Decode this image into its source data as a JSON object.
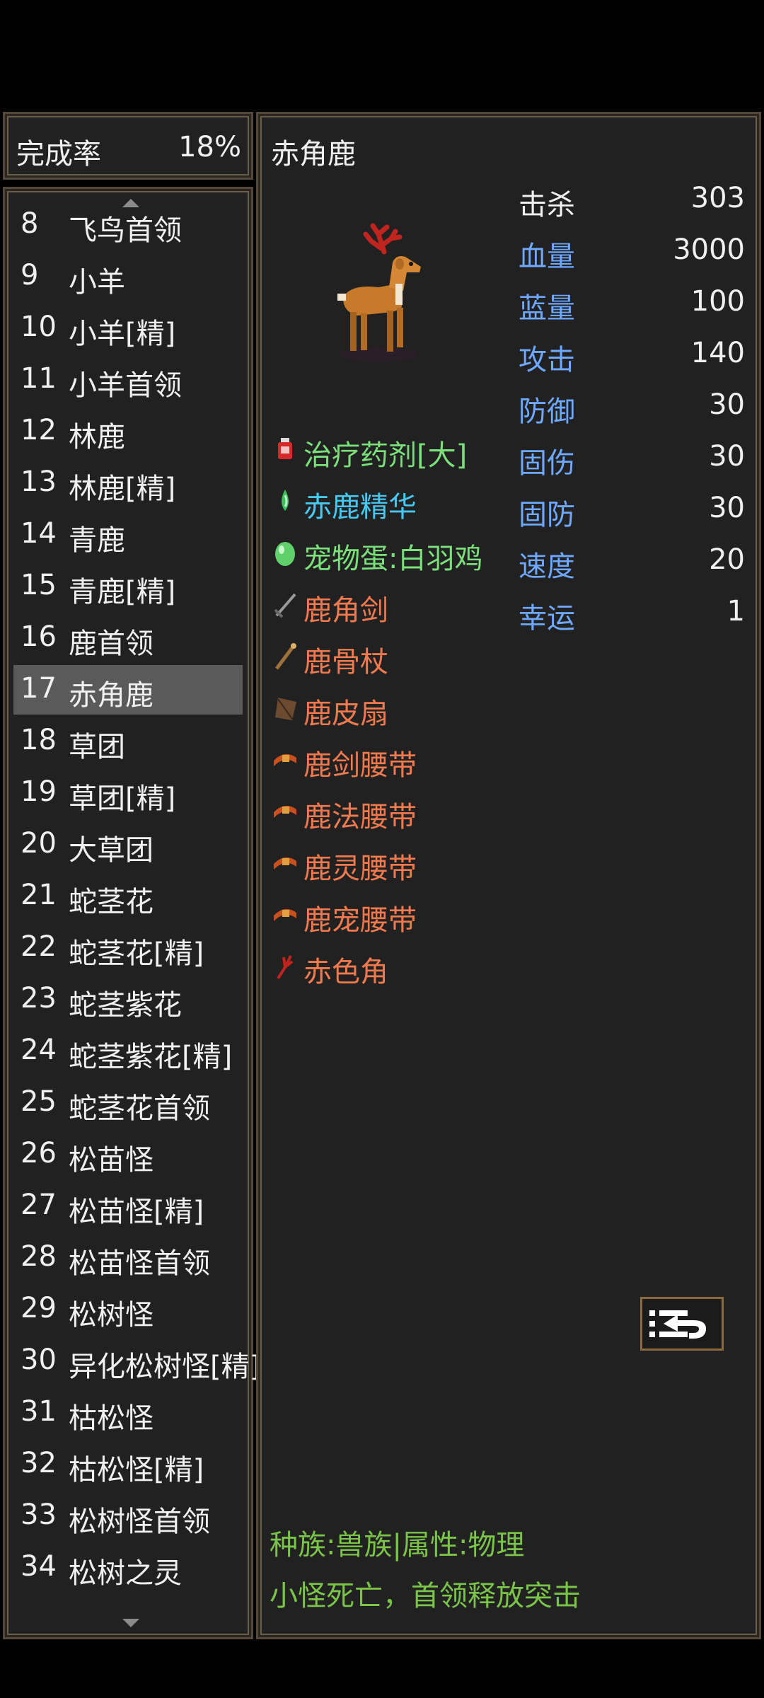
{
  "completion": {
    "label": "完成率",
    "value": "18%"
  },
  "monster_list": [
    {
      "num": "8",
      "name": "飞鸟首领"
    },
    {
      "num": "9",
      "name": "小羊"
    },
    {
      "num": "10",
      "name": "小羊[精]"
    },
    {
      "num": "11",
      "name": "小羊首领"
    },
    {
      "num": "12",
      "name": "林鹿"
    },
    {
      "num": "13",
      "name": "林鹿[精]"
    },
    {
      "num": "14",
      "name": "青鹿"
    },
    {
      "num": "15",
      "name": "青鹿[精]"
    },
    {
      "num": "16",
      "name": "鹿首领"
    },
    {
      "num": "17",
      "name": "赤角鹿"
    },
    {
      "num": "18",
      "name": "草团"
    },
    {
      "num": "19",
      "name": "草团[精]"
    },
    {
      "num": "20",
      "name": "大草团"
    },
    {
      "num": "21",
      "name": "蛇茎花"
    },
    {
      "num": "22",
      "name": "蛇茎花[精]"
    },
    {
      "num": "23",
      "name": "蛇茎紫花"
    },
    {
      "num": "24",
      "name": "蛇茎紫花[精]"
    },
    {
      "num": "25",
      "name": "蛇茎花首领"
    },
    {
      "num": "26",
      "name": "松苗怪"
    },
    {
      "num": "27",
      "name": "松苗怪[精]"
    },
    {
      "num": "28",
      "name": "松苗怪首领"
    },
    {
      "num": "29",
      "name": "松树怪"
    },
    {
      "num": "30",
      "name": "异化松树怪[精]"
    },
    {
      "num": "31",
      "name": "枯松怪"
    },
    {
      "num": "32",
      "name": "枯松怪[精]"
    },
    {
      "num": "33",
      "name": "松树怪首领"
    },
    {
      "num": "34",
      "name": "松树之灵"
    }
  ],
  "selected_index": 9,
  "monster": {
    "name": "赤角鹿",
    "stats": [
      {
        "label": "击杀",
        "value": "303",
        "color": "white"
      },
      {
        "label": "血量",
        "value": "3000",
        "color": "blue"
      },
      {
        "label": "蓝量",
        "value": "100",
        "color": "blue"
      },
      {
        "label": "攻击",
        "value": "140",
        "color": "blue"
      },
      {
        "label": "防御",
        "value": "30",
        "color": "blue"
      },
      {
        "label": "固伤",
        "value": "30",
        "color": "blue"
      },
      {
        "label": "固防",
        "value": "30",
        "color": "blue"
      },
      {
        "label": "速度",
        "value": "20",
        "color": "blue"
      },
      {
        "label": "幸运",
        "value": "1",
        "color": "blue"
      }
    ],
    "drops": [
      {
        "name": "治疗药剂[大]",
        "color": "green",
        "icon": "potion-icon"
      },
      {
        "name": "赤鹿精华",
        "color": "cyan",
        "icon": "essence-icon"
      },
      {
        "name": "宠物蛋:白羽鸡",
        "color": "green",
        "icon": "egg-icon"
      },
      {
        "name": "鹿角剑",
        "color": "orange",
        "icon": "sword-icon"
      },
      {
        "name": "鹿骨杖",
        "color": "orange",
        "icon": "staff-icon"
      },
      {
        "name": "鹿皮扇",
        "color": "orange",
        "icon": "fan-icon"
      },
      {
        "name": "鹿剑腰带",
        "color": "orange",
        "icon": "belt-icon"
      },
      {
        "name": "鹿法腰带",
        "color": "orange",
        "icon": "belt-icon"
      },
      {
        "name": "鹿灵腰带",
        "color": "orange",
        "icon": "belt-icon"
      },
      {
        "name": "鹿宠腰带",
        "color": "orange",
        "icon": "belt-icon"
      },
      {
        "name": "赤色角",
        "color": "orange",
        "icon": "antler-icon"
      }
    ],
    "info_line1": "种族:兽族|属性:物理",
    "info_line2": "小怪死亡，首领释放突击"
  },
  "colors": {
    "panel_bg": "#212121",
    "border": "#54483a",
    "stat_blue": "#6fa8ff",
    "item_green": "#7be07b",
    "item_cyan": "#48c8f0",
    "item_orange": "#f07a50",
    "info_green": "#7bc44a",
    "selected_bg": "#5a5a5a"
  }
}
